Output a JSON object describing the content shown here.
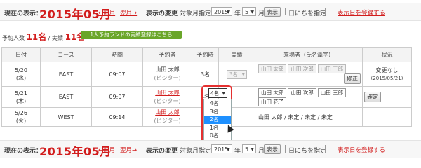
{
  "nav": {
    "current_label": "現在の表示：",
    "current_value": "2015年05月",
    "prev_label": "←前月",
    "next_label": "翌月→",
    "change_label": "表示の変更",
    "target_label": "対象月指定",
    "year_value": "2015",
    "year_suffix": "年",
    "month_value": "5",
    "month_suffix": "月",
    "show_button": "表示",
    "date_specify_button": "日にちを指定",
    "set_display_day_link": "表示日を登録する"
  },
  "summary": {
    "reservations_label": "予約人数",
    "reservations_value": "11名",
    "separator": " / 実績 ",
    "actual_value": "11名",
    "green_button": "1人予約ランドの実績登録はこちら"
  },
  "table": {
    "headers": [
      "日付",
      "コース",
      "時間",
      "予約者",
      "予約時",
      "実績",
      "来場者（氏名漢字）",
      "状況"
    ],
    "rows": [
      {
        "date": "5/20",
        "weekday": "(水)",
        "course": "EAST",
        "time": "09:07",
        "booker": "山田 太郎",
        "booker_sub": "(ビジター)",
        "reserved": "3名",
        "actual": "3名",
        "visitors": [
          "山田 太郎",
          "山田 次郎",
          "山田 三郎"
        ],
        "button": "修正",
        "status": "変更なし",
        "status_date": "(2015/05/21)"
      },
      {
        "date": "5/21",
        "weekday": "(木)",
        "course": "EAST",
        "time": "09:07",
        "booker": "山田 太郎",
        "booker_sub": "(ビジター)",
        "reserved": "4名",
        "actual": "4名",
        "visitors": [
          "山田 太郎",
          "山田 次郎",
          "山田 三郎",
          "山田 花子"
        ],
        "button": "確定",
        "status": "",
        "status_date": ""
      },
      {
        "date": "5/26",
        "weekday": "(火)",
        "course": "WEST",
        "time": "09:14",
        "booker": "山田 太郎",
        "booker_sub": "(ビジター)",
        "reserved": "4名",
        "actual": "",
        "visitors_text": "山田 太郎 / 未定 / 未定 / 未定",
        "status": "",
        "status_date": ""
      }
    ]
  },
  "dropdown": {
    "options": [
      "4名",
      "3名",
      "2名",
      "1名",
      "0名"
    ],
    "highlighted": "2名"
  },
  "colors": {
    "accent": "#d21d1d",
    "green": "#6aa629",
    "highlight": "#1e90ff",
    "ring": "#e53030"
  }
}
